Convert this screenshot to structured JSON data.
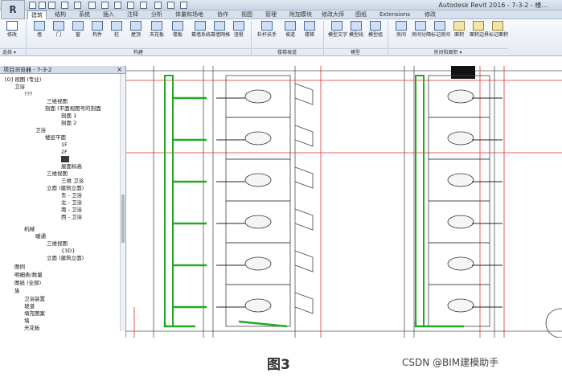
{
  "window": {
    "title": "Autodesk Revit 2016 -   7-3-2 - 楼..."
  },
  "qat": {
    "logo": "R"
  },
  "tabs": [
    "建筑",
    "结构",
    "系统",
    "插入",
    "注释",
    "分析",
    "体量和场地",
    "协作",
    "视图",
    "管理",
    "附加模块",
    "修改大师",
    "图纸",
    "Extensions",
    "修改"
  ],
  "ribbon": {
    "buttons": [
      "修改",
      "墙",
      "门",
      "窗",
      "构件",
      "柱",
      "屋顶",
      "天花板",
      "楼板",
      "幕墙系统",
      "幕墙网格",
      "竖梃",
      "栏杆扶手",
      "坡道",
      "楼梯",
      "模型文字",
      "模型线",
      "模型组",
      "房间",
      "房间分隔",
      "标记房间",
      "面积",
      "面积边界",
      "标记面积"
    ],
    "panels": [
      "选择 ▾",
      "构建",
      "楼梯坡道",
      "模型",
      "房间和面积 ▾"
    ]
  },
  "browser": {
    "title": "项目浏览器 - 7-3-2",
    "close": "×",
    "nodes": [
      "[O] 视图 (专业)",
      "卫浴",
      "???",
      "三维视图",
      "剖面 (平面视图号的剖面",
      "剖面 1",
      "剖面 2",
      "卫浴",
      "楼层平面",
      "1F",
      "2F",
      "屋面标高",
      "三维视图",
      "三维 卫浴",
      "立面 (建筑立面)",
      "东 - 卫浴",
      "北 - 卫浴",
      "南 - 卫浴",
      "西 - 卫浴",
      "机械",
      "暖通",
      "三维视图",
      "{3D}",
      "立面 (建筑立面)",
      "图例",
      "明细表/数量",
      "图纸 (全部)",
      "族",
      "卫浴装置",
      "坡道",
      "填充图案",
      "墙",
      "天花板"
    ]
  },
  "caption": "图3",
  "watermark": "CSDN @BIM建模助手"
}
